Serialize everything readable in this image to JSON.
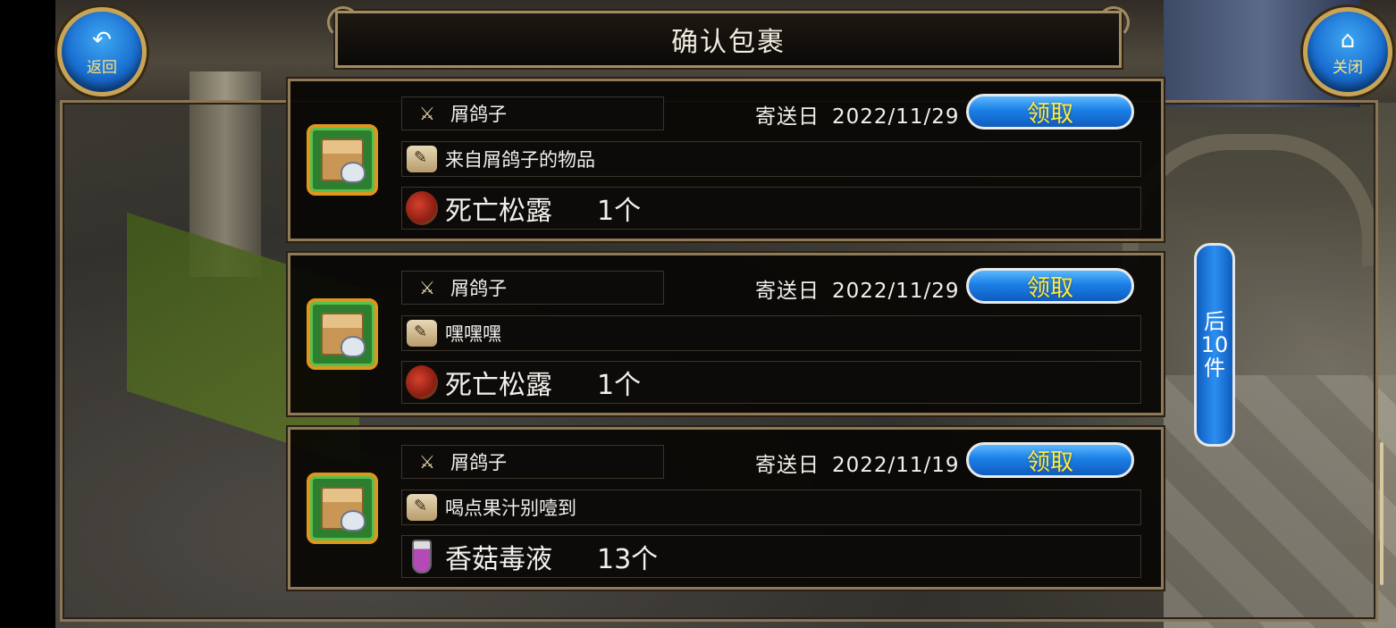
{
  "header": {
    "title": "确认包裹",
    "back_button": {
      "label": "返回",
      "icon": "back-arrow-icon"
    },
    "close_button": {
      "label": "关闭",
      "icon": "home-icon"
    }
  },
  "mail_list": {
    "date_prefix": "寄送日",
    "claim_label": "领取",
    "items": [
      {
        "sender": "屑鸽子",
        "date": "2022/11/29",
        "message": "来自屑鸽子的物品",
        "item_name": "死亡松露",
        "item_qty": "1个",
        "item_icon": "truffle-icon"
      },
      {
        "sender": "屑鸽子",
        "date": "2022/11/29",
        "message": "嘿嘿嘿",
        "item_name": "死亡松露",
        "item_qty": "1个",
        "item_icon": "truffle-icon"
      },
      {
        "sender": "屑鸽子",
        "date": "2022/11/19",
        "message": "喝点果汁别噎到",
        "item_name": "香菇毒液",
        "item_qty": "13个",
        "item_icon": "potion-vial-icon"
      }
    ]
  },
  "pager": {
    "next_label": "后\n10\n件"
  },
  "colors": {
    "claim_text": "#ffeb3b",
    "button_blue": "#1b7fe6",
    "frame_gold": "#a38b60",
    "package_border": "#e0951d"
  }
}
